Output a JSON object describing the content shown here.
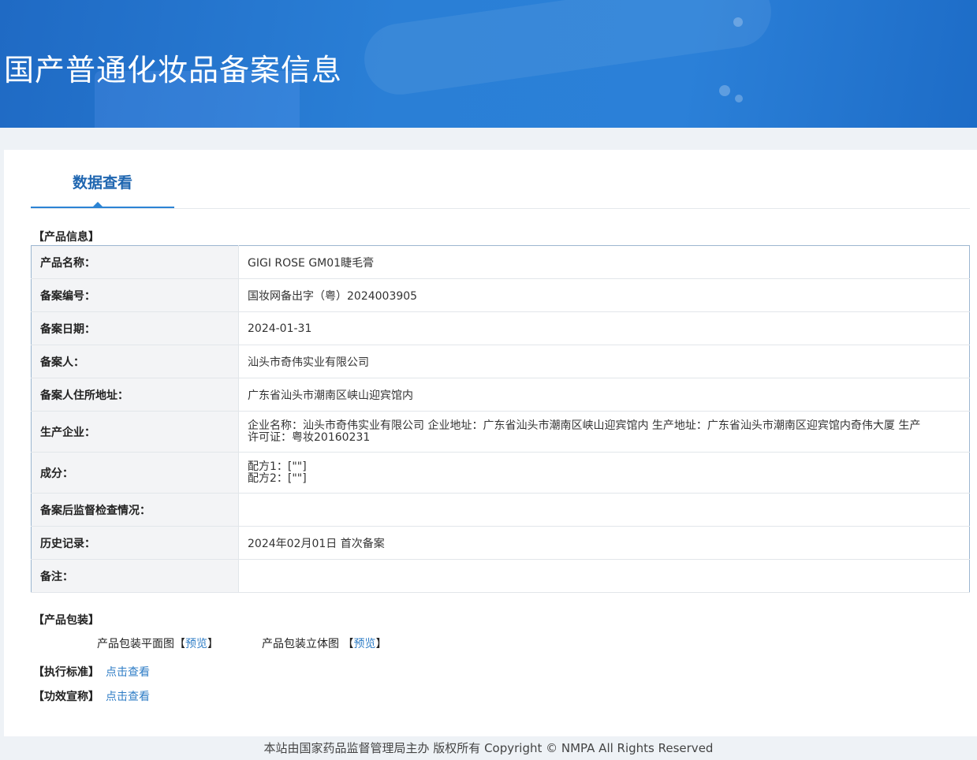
{
  "banner": {
    "title": "国产普通化妆品备案信息"
  },
  "tabs": [
    {
      "label": "数据查看"
    }
  ],
  "product_info": {
    "section_title": "【产品信息】",
    "rows": [
      {
        "label": "产品名称：",
        "value": "GIGI ROSE GM01睫毛膏"
      },
      {
        "label": "备案编号：",
        "value": "国妆网备出字（粤）2024003905"
      },
      {
        "label": "备案日期：",
        "value": "2024-01-31"
      },
      {
        "label": "备案人：",
        "value": "汕头市奇伟实业有限公司"
      },
      {
        "label": "备案人住所地址：",
        "value": "广东省汕头市潮南区峡山迎宾馆内"
      },
      {
        "label": "生产企业：",
        "value_line1": "企业名称：汕头市奇伟实业有限公司 企业地址：广东省汕头市潮南区峡山迎宾馆内 生产地址：广东省汕头市潮南区迎宾馆内奇伟大厦 生产",
        "value_line2": "许可证：粤妆20160231"
      },
      {
        "label": "成分：",
        "value_line1": "配方1：[\"\"]",
        "value_line2": "配方2：[\"\"]"
      },
      {
        "label": "备案后监督检查情况：",
        "value": ""
      },
      {
        "label": "历史记录：",
        "value": "2024年02月01日 首次备案"
      },
      {
        "label": "备注：",
        "value": ""
      }
    ]
  },
  "packaging": {
    "section_title": "【产品包装】",
    "flat_label": "产品包装平面图",
    "solid_label": "产品包装立体图",
    "bracket_open": "【",
    "bracket_close": "】",
    "preview_link": "预览"
  },
  "standard": {
    "label": "【执行标准】",
    "link": "点击查看"
  },
  "efficacy": {
    "label": "【功效宣称】",
    "link": "点击查看"
  },
  "footer": {
    "text": "本站由国家药品监督管理局主办 版权所有 Copyright © NMPA All Rights Reserved"
  }
}
